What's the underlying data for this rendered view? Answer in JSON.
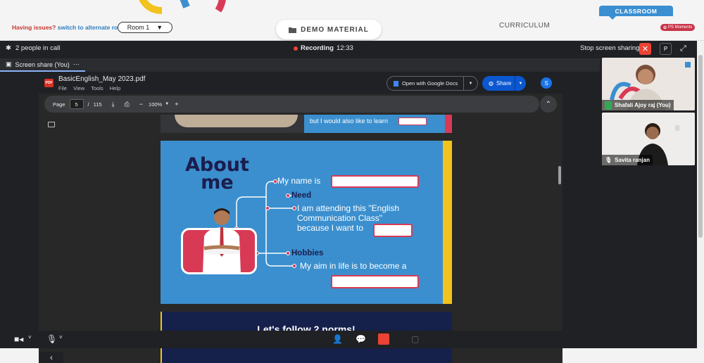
{
  "header": {
    "issues_text": "Having issues?",
    "alternate_link": "switch to alternate room",
    "room_label": "Room 1",
    "demo_tab": "DEMO MATERIAL",
    "curriculum_tab": "CURRICULUM",
    "classroom_tab": "CLASSROOM",
    "moments_badge": "PS Moments"
  },
  "meet": {
    "people_count": "2 people in call",
    "recording_label": "Recording",
    "recording_time": "12:33",
    "stop_sharing": "Stop screen sharing",
    "p_button": "P",
    "share_tab": "Screen share (You)",
    "more": "⋯"
  },
  "pdf": {
    "file_name": "BasicEnglish_May 2023.pdf",
    "icon_label": "PDF",
    "menu": [
      "File",
      "View",
      "Tools",
      "Help"
    ],
    "open_docs": "Open with Google Docs",
    "share_label": "Share",
    "avatar_letter": "S",
    "page_label": "Page",
    "current_page": "5",
    "page_sep": "/",
    "total_pages": "115",
    "zoom": "100%"
  },
  "slides": {
    "prev_text": "but I would also like to learn",
    "about_line1": "About",
    "about_line2": "me",
    "name_line": "My name is",
    "need_label": "Need",
    "attending_line1": "I am attending this \"English",
    "attending_line2": "Communication Class\"",
    "attending_line3": "because I want to",
    "hobbies_label": "Hobbies",
    "aim_line": "My aim in life is to become a",
    "norms_title": "Let's follow 2 norms!"
  },
  "participants": [
    {
      "name": "Shafali Ajoy raj (You)",
      "mic": "on"
    },
    {
      "name": "Savita ranjan",
      "mic": "muted"
    }
  ],
  "colors": {
    "slide_blue": "#3b8fce",
    "accent_red": "#d83a55",
    "slide_navy": "#1b1d4e",
    "recording_red": "#ea4335"
  }
}
